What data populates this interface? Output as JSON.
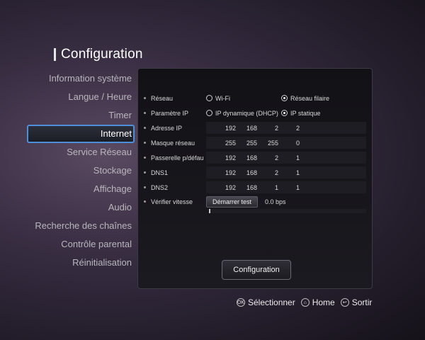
{
  "title": "Configuration",
  "sidebar": {
    "items": [
      {
        "label": "Information système"
      },
      {
        "label": "Langue / Heure"
      },
      {
        "label": "Timer"
      },
      {
        "label": "Internet",
        "active": true
      },
      {
        "label": "Service Réseau"
      },
      {
        "label": "Stockage"
      },
      {
        "label": "Affichage"
      },
      {
        "label": "Audio"
      },
      {
        "label": "Recherche des chaînes"
      },
      {
        "label": "Contrôle parental"
      },
      {
        "label": "Réinitialisation"
      }
    ]
  },
  "panel": {
    "network": {
      "label": "Réseau",
      "options": [
        "Wi-Fi",
        "Réseau filaire"
      ],
      "selected": "Réseau filaire"
    },
    "ip_param": {
      "label": "Paramètre IP",
      "options": [
        "IP dynamique (DHCP)",
        "IP statique"
      ],
      "selected": "IP statique"
    },
    "ip_address": {
      "label": "Adresse IP",
      "octets": [
        "192",
        "168",
        "2",
        "2"
      ]
    },
    "subnet_mask": {
      "label": "Masque réseau",
      "octets": [
        "255",
        "255",
        "255",
        "0"
      ]
    },
    "gateway": {
      "label": "Passerelle p/défau",
      "octets": [
        "192",
        "168",
        "2",
        "1"
      ]
    },
    "dns1": {
      "label": "DNS1",
      "octets": [
        "192",
        "168",
        "2",
        "1"
      ]
    },
    "dns2": {
      "label": "DNS2",
      "octets": [
        "192",
        "168",
        "1",
        "1"
      ]
    },
    "speed_test": {
      "label": "Vérifier vitesse",
      "button": "Démarrer test",
      "result": "0.0 bps",
      "progress": 0.01
    },
    "config_button": "Configuration"
  },
  "footer": {
    "select": {
      "icon": "OK",
      "label": "Sélectionner"
    },
    "home": {
      "icon": "⌂",
      "label": "Home"
    },
    "exit": {
      "icon": "↩",
      "label": "Sortir"
    }
  },
  "colors": {
    "active_border": "#4f8fd8",
    "panel_bg": "#121116"
  }
}
